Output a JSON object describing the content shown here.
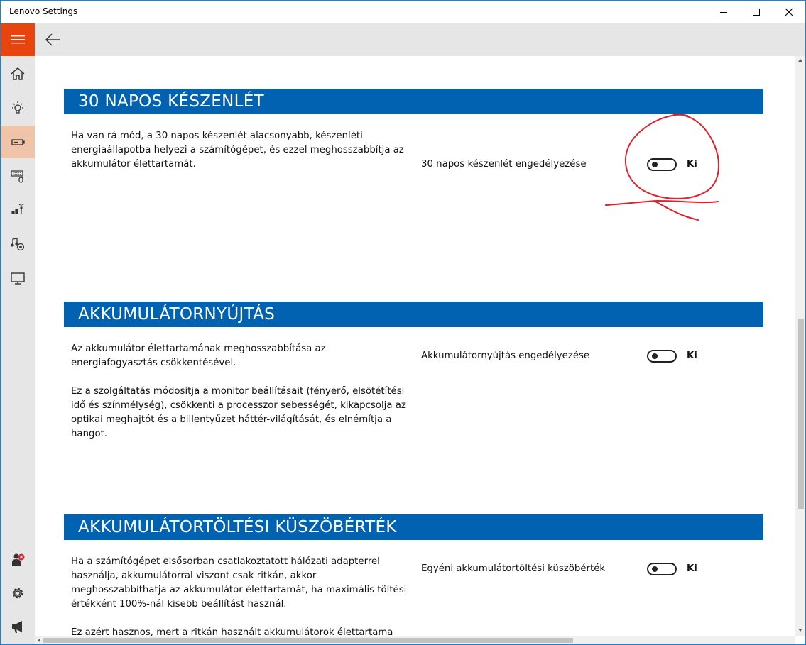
{
  "window": {
    "title": "Lenovo Settings",
    "accent_color": "#e8450e",
    "header_color": "#0062b1"
  },
  "titlebar": {
    "icons": [
      "minimize-icon",
      "maximize-icon",
      "close-icon"
    ]
  },
  "sidebar": {
    "items": [
      {
        "icon": "home-icon"
      },
      {
        "icon": "lightbulb-icon"
      },
      {
        "icon": "battery-icon",
        "active": true
      },
      {
        "icon": "keyboard-mouse-icon"
      },
      {
        "icon": "network-icon"
      },
      {
        "icon": "audio-video-icon"
      },
      {
        "icon": "display-icon"
      }
    ],
    "bottom": [
      {
        "icon": "user-alert-icon"
      },
      {
        "icon": "gear-icon"
      },
      {
        "icon": "megaphone-icon"
      }
    ]
  },
  "sections": [
    {
      "heading": "30 NAPOS KÉSZENLÉT",
      "paragraphs": [
        "Ha van rá mód, a 30 napos készenlét alacsonyabb, készenléti energiaállapotba helyezi a számítógépet, és ezzel meghosszabbítja az akkumulátor élettartamát."
      ],
      "setting_label": "30 napos készenlét engedélyezése",
      "toggle_state": "Ki",
      "toggle_on": false
    },
    {
      "heading": "AKKUMULÁTORNYÚJTÁS",
      "paragraphs": [
        "Az akkumulátor élettartamának meghosszabbítása az energiafogyasztás csökkentésével.",
        "Ez a szolgáltatás módosítja a monitor beállításait (fényerő, elsötétítési idő és színmélység), csökkenti a processzor sebességét, kikapcsolja az optikai meghajtót és a billentyűzet háttér-világítását, és elnémítja a hangot."
      ],
      "setting_label": "Akkumulátornyújtás engedélyezése",
      "toggle_state": "Ki",
      "toggle_on": false
    },
    {
      "heading": "AKKUMULÁTORTÖLTÉSI KÜSZÖBÉRTÉK",
      "paragraphs": [
        "Ha a számítógépet elsősorban csatlakoztatott hálózati adapterrel használja, akkumulátorral viszont csak ritkán, akkor meghosszabbíthatja az akkumulátor élettartamát, ha maximális töltési értékként 100%-nál kisebb beállítást használ.",
        "Ez azért hasznos, mert a ritkán használt akkumulátorok élettartama"
      ],
      "setting_label": "Egyéni akkumulátortöltési küszöbérték",
      "toggle_state": "Ki",
      "toggle_on": false
    }
  ],
  "annotation": {
    "color": "#e0202a"
  }
}
